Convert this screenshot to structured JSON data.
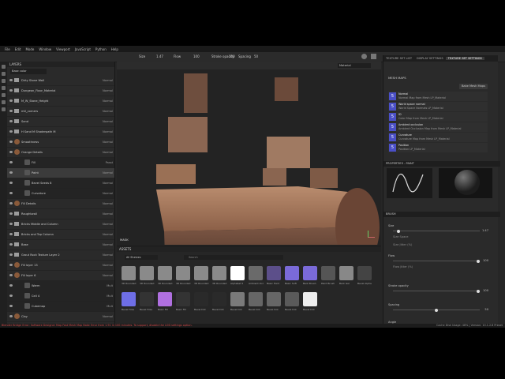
{
  "menu": [
    "File",
    "Edit",
    "Mode",
    "Window",
    "Viewport",
    "JavaScript",
    "Python",
    "Help"
  ],
  "toolbar": {
    "size_label": "Size",
    "size_value": "1.47",
    "flow_label": "Flow",
    "flow_value": "100",
    "stroke_label": "Stroke opacity",
    "stroke_value": "100",
    "spacing_label": "Spacing",
    "spacing_value": "50"
  },
  "layers": {
    "title": "LAYERS",
    "blend_select": "Base color",
    "rows": [
      {
        "name": "Dirty Stone Wall",
        "blend": "Normal",
        "kind": "folder"
      },
      {
        "name": "Dungeon_Floor_Material",
        "blend": "Normal",
        "kind": "folder"
      },
      {
        "name": "M_W_Stone_Height",
        "blend": "Normal",
        "kind": "folder"
      },
      {
        "name": "mtl_corners",
        "blend": "Normal",
        "kind": "folder"
      },
      {
        "name": "Sand",
        "blend": "Normal",
        "kind": "folder"
      },
      {
        "name": "H Sand M Shaderpath M",
        "blend": "Normal",
        "kind": "folder"
      },
      {
        "name": "Smoothness",
        "blend": "Normal",
        "kind": "fill"
      },
      {
        "name": "Orange Details",
        "blend": "Normal",
        "kind": "fill"
      },
      {
        "name": "Fill",
        "blend": "Passt",
        "kind": "sub"
      },
      {
        "name": "Paint",
        "blend": "Normal",
        "kind": "sub"
      },
      {
        "name": "Bevel Seeds 8",
        "blend": "Normal",
        "kind": "sub"
      },
      {
        "name": "Curvature",
        "blend": "Normal",
        "kind": "sub"
      },
      {
        "name": "Fill Details",
        "blend": "Normal",
        "kind": "fill"
      },
      {
        "name": "Roughtwall",
        "blend": "Normal",
        "kind": "folder"
      },
      {
        "name": "Bricks Middle and Column",
        "blend": "Normal",
        "kind": "folder"
      },
      {
        "name": "Bricks and Top Column",
        "blend": "Normal",
        "kind": "folder"
      },
      {
        "name": "Base",
        "blend": "Normal",
        "kind": "folder"
      },
      {
        "name": "Grout Rock Texture Layer 2",
        "blend": "Normal",
        "kind": "folder"
      },
      {
        "name": "Fill layer 13",
        "blend": "Normal",
        "kind": "fill"
      },
      {
        "name": "Fill layer 6",
        "blend": "Normal",
        "kind": "fill"
      },
      {
        "name": "Warm",
        "blend": "Mult",
        "kind": "sub"
      },
      {
        "name": "Cell 4",
        "blend": "Mult",
        "kind": "sub"
      },
      {
        "name": "Cubemap",
        "blend": "Mult",
        "kind": "sub"
      },
      {
        "name": "Clay",
        "blend": "Normal",
        "kind": "fill"
      }
    ]
  },
  "viewport": {
    "material_select": "Material",
    "mask_label": "MASK"
  },
  "right": {
    "tabs": [
      "TEXTURE SET LIST",
      "DISPLAY SETTINGS",
      "TEXTURE SET SETTINGS"
    ],
    "mesh_maps_title": "MESH MAPS",
    "bake_button": "Bake Mesh Maps",
    "mesh_maps": [
      {
        "badge": "5",
        "title": "Normal",
        "sub": "Normal Map from Mesh LP_Material"
      },
      {
        "badge": "5",
        "title": "World space normal",
        "sub": "World Space Normals LP_Material"
      },
      {
        "badge": "5",
        "title": "ID",
        "sub": "Color Map from Mesh LP_Material"
      },
      {
        "badge": "5",
        "title": "Ambient occlusion",
        "sub": "Ambient Occlusion Map from Mesh LP_Material"
      },
      {
        "badge": "5",
        "title": "Curvature",
        "sub": "Curvature Map from Mesh LP_Material"
      },
      {
        "badge": "5",
        "title": "Position",
        "sub": "Position LP_Material"
      }
    ],
    "properties_title": "PROPERTIES - PAINT",
    "brush_title": "BRUSH",
    "brush": [
      {
        "label": "Size",
        "value": "1.47",
        "level": 0.05
      },
      {
        "label": "Flow",
        "value": "100",
        "level": 1.0
      },
      {
        "label": "Stroke opacity",
        "value": "100",
        "level": 1.0
      },
      {
        "label": "Spacing",
        "value": "50",
        "level": 0.5
      },
      {
        "label": "Angle",
        "value": "0",
        "level": 0.25
      }
    ],
    "sub_labels": [
      "Size Space",
      "Size Jitter (%)",
      "Flow Jitter (%)"
    ]
  },
  "assets": {
    "title": "ASSETS",
    "search_placeholder": "Search",
    "filter": "All Shelves",
    "labels": [
      "3D Rounded",
      "3D Rounded",
      "3D Rounded",
      "3D Rounded",
      "3D Rounded",
      "3D Rounded",
      "Alphabet 5",
      "Ambient Occ",
      "Basic Hard",
      "Basic Soft",
      "Bark Brush",
      "Paint Brush",
      "Bark Gel",
      "Bevel Alpha",
      "Bevel Hole",
      "Bevel Hole",
      "Basic Fill",
      "Basic Fill",
      "Bevel Dot",
      "Bevel Dot",
      "Bevel Dot",
      "Bevel Dot",
      "Bevel Dot",
      "Bevel Dot",
      "Bevel Dot"
    ]
  },
  "status": "Blender Bridge Error: Software Designer Map Fast Mesh Map Bake Error from 1.91 in 100 minutes. To support, disable the LOD settings option.",
  "statusbar_right": "Cache Disk Usage: 48%  |  Version: 10.1.2.8 Preset"
}
